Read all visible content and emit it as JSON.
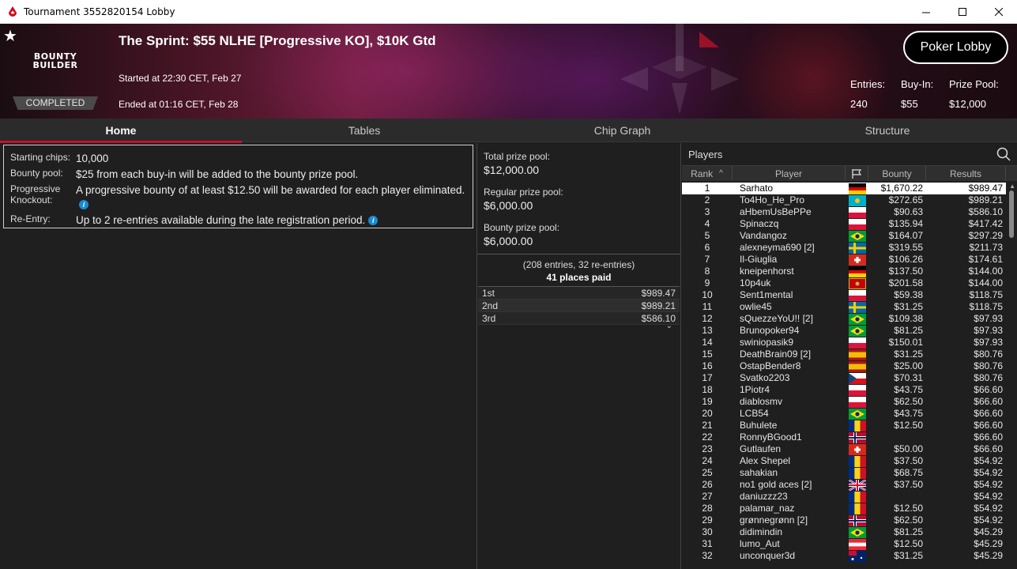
{
  "window": {
    "title": "Tournament 3552820154 Lobby"
  },
  "header": {
    "logo_text_1": "BOUNTY",
    "logo_text_2": "BUILDER",
    "status": "COMPLETED",
    "tournament_name": "The Sprint: $55 NLHE [Progressive KO], $10K Gtd",
    "started": "Started at 22:30 CET, Feb 27",
    "ended": "Ended at 01:16 CET, Feb 28",
    "lobby_button": "Poker Lobby",
    "entries_label": "Entries:",
    "entries_value": "240",
    "buyin_label": "Buy-In:",
    "buyin_value": "$55",
    "prizepool_label": "Prize Pool:",
    "prizepool_value": "$12,000"
  },
  "tabs": [
    "Home",
    "Tables",
    "Chip Graph",
    "Structure"
  ],
  "info": {
    "starting_chips_label": "Starting chips:",
    "starting_chips_value": "10,000",
    "bounty_pool_label": "Bounty pool:",
    "bounty_pool_value": "$25 from each buy-in will be added to the bounty prize pool.",
    "progressive_label": "Progressive Knockout:",
    "progressive_value": "A progressive bounty of at least $12.50 will be awarded for each player eliminated.",
    "reentry_label": "Re-Entry:",
    "reentry_value": "Up to 2 re-entries available during the late registration period."
  },
  "prizes": {
    "total_label": "Total prize pool:",
    "total_value": "$12,000.00",
    "regular_label": "Regular prize pool:",
    "regular_value": "$6,000.00",
    "bounty_label": "Bounty prize pool:",
    "bounty_value": "$6,000.00",
    "entries_note": "(208 entries, 32 re-entries)",
    "places_paid": "41 places paid",
    "payouts": [
      {
        "place": "1st",
        "amount": "$989.47"
      },
      {
        "place": "2nd",
        "amount": "$989.21"
      },
      {
        "place": "3rd",
        "amount": "$586.10"
      }
    ]
  },
  "players": {
    "title": "Players",
    "columns": {
      "rank": "Rank",
      "player": "Player",
      "bounty": "Bounty",
      "results": "Results"
    },
    "rows": [
      {
        "rank": "1",
        "name": "Sarhato",
        "flag": "de",
        "bounty": "$1,670.22",
        "result": "$989.47"
      },
      {
        "rank": "2",
        "name": "To4Ho_He_Pro",
        "flag": "kz",
        "bounty": "$272.65",
        "result": "$989.21"
      },
      {
        "rank": "3",
        "name": "aHbemUsBePPe",
        "flag": "pl",
        "bounty": "$90.63",
        "result": "$586.10"
      },
      {
        "rank": "4",
        "name": "Spinaczq",
        "flag": "pl",
        "bounty": "$135.94",
        "result": "$417.42"
      },
      {
        "rank": "5",
        "name": "Vandangoz",
        "flag": "br",
        "bounty": "$164.07",
        "result": "$297.29"
      },
      {
        "rank": "6",
        "name": "alexneyma690 [2]",
        "flag": "se",
        "bounty": "$319.55",
        "result": "$211.73"
      },
      {
        "rank": "7",
        "name": "Il-Giuglia",
        "flag": "ch",
        "bounty": "$106.26",
        "result": "$174.61"
      },
      {
        "rank": "8",
        "name": "kneipenhorst",
        "flag": "de",
        "bounty": "$137.50",
        "result": "$144.00"
      },
      {
        "rank": "9",
        "name": "10p4uk",
        "flag": "me",
        "bounty": "$201.58",
        "result": "$144.00"
      },
      {
        "rank": "10",
        "name": "Sent1mental",
        "flag": "pl",
        "bounty": "$59.38",
        "result": "$118.75"
      },
      {
        "rank": "11",
        "name": "owlie45",
        "flag": "se",
        "bounty": "$31.25",
        "result": "$118.75"
      },
      {
        "rank": "12",
        "name": "sQuezzeYoU!! [2]",
        "flag": "br",
        "bounty": "$109.38",
        "result": "$97.93"
      },
      {
        "rank": "13",
        "name": "Brunopoker94",
        "flag": "br",
        "bounty": "$81.25",
        "result": "$97.93"
      },
      {
        "rank": "14",
        "name": "swiniopasik9",
        "flag": "pl",
        "bounty": "$150.01",
        "result": "$97.93"
      },
      {
        "rank": "15",
        "name": "DeathBrain09 [2]",
        "flag": "es",
        "bounty": "$31.25",
        "result": "$80.76"
      },
      {
        "rank": "16",
        "name": "OstapBender8",
        "flag": "es",
        "bounty": "$25.00",
        "result": "$80.76"
      },
      {
        "rank": "17",
        "name": "Svatko2203",
        "flag": "cz",
        "bounty": "$70.31",
        "result": "$80.76"
      },
      {
        "rank": "18",
        "name": "1Piotr4",
        "flag": "pl",
        "bounty": "$43.75",
        "result": "$66.60"
      },
      {
        "rank": "19",
        "name": "diablosmv",
        "flag": "pl",
        "bounty": "$62.50",
        "result": "$66.60"
      },
      {
        "rank": "20",
        "name": "LCB54",
        "flag": "br",
        "bounty": "$43.75",
        "result": "$66.60"
      },
      {
        "rank": "21",
        "name": "Buhulete",
        "flag": "ro",
        "bounty": "$12.50",
        "result": "$66.60"
      },
      {
        "rank": "22",
        "name": "RonnyBGood1",
        "flag": "no",
        "bounty": "",
        "result": "$66.60"
      },
      {
        "rank": "23",
        "name": "Gutlaufen",
        "flag": "ch",
        "bounty": "$50.00",
        "result": "$66.60"
      },
      {
        "rank": "24",
        "name": "Alex Shepel",
        "flag": "ro",
        "bounty": "$37.50",
        "result": "$54.92"
      },
      {
        "rank": "25",
        "name": "sahakian",
        "flag": "ro",
        "bounty": "$68.75",
        "result": "$54.92"
      },
      {
        "rank": "26",
        "name": "no1 gold aces [2]",
        "flag": "gb",
        "bounty": "$37.50",
        "result": "$54.92"
      },
      {
        "rank": "27",
        "name": "daniuzzz23",
        "flag": "ro",
        "bounty": "",
        "result": "$54.92"
      },
      {
        "rank": "28",
        "name": "palamar_naz",
        "flag": "ro",
        "bounty": "$12.50",
        "result": "$54.92"
      },
      {
        "rank": "29",
        "name": "grønnegrønn [2]",
        "flag": "no",
        "bounty": "$62.50",
        "result": "$54.92"
      },
      {
        "rank": "30",
        "name": "didimindin",
        "flag": "br",
        "bounty": "$81.25",
        "result": "$45.29"
      },
      {
        "rank": "31",
        "name": "lumo_Aut",
        "flag": "at",
        "bounty": "$12.50",
        "result": "$45.29"
      },
      {
        "rank": "32",
        "name": "unconquer3d",
        "flag": "au",
        "bounty": "$31.25",
        "result": "$45.29"
      }
    ]
  }
}
